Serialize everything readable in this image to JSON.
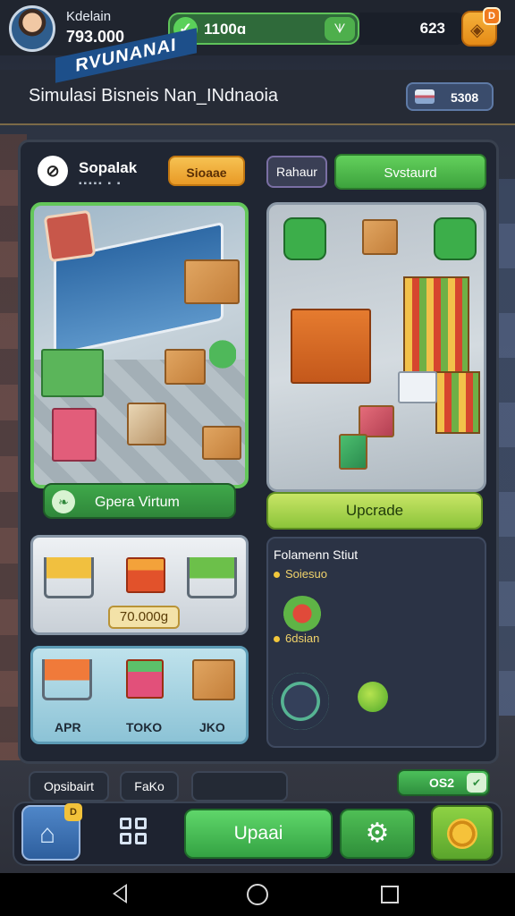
{
  "player": {
    "name": "Kdelain",
    "money": "793.000"
  },
  "resources": {
    "energy": "1100ɑ",
    "energy_plus": "ᗐ",
    "gems": "623",
    "gem_badge": "D"
  },
  "header": {
    "title": "Simulasi Bisneis Nan_INdnaoia",
    "books": "5308"
  },
  "panel": {
    "section_title": "Sopalak",
    "section_sub": "▪▪▪▪▪ ▪ ▪",
    "orange_button": "Sioaae",
    "tab_rahaur": "Rahaur",
    "green_button": "Svstaurd",
    "store_sign": "RVUNANAI",
    "open_button": "Gpera Virtum",
    "upgrade_button": "Upcrade",
    "goods_price": "70.000g",
    "shop_labels": [
      "APR",
      "TOKO",
      "JKO"
    ]
  },
  "stats": {
    "title": "Folamenn Stiut",
    "row1": "Soiesuo",
    "row2": "6dsian"
  },
  "lower_tabs": {
    "tab1": "Opsibairt",
    "tab2": "FaKo",
    "count": "OS2",
    "count_arrow": "✔"
  },
  "toolbar": {
    "home_badge": "D",
    "upgrade": "Upaai"
  },
  "colors": {
    "accent_green": "#4cc05a",
    "accent_orange": "#f0a330",
    "panel": "#202633"
  }
}
